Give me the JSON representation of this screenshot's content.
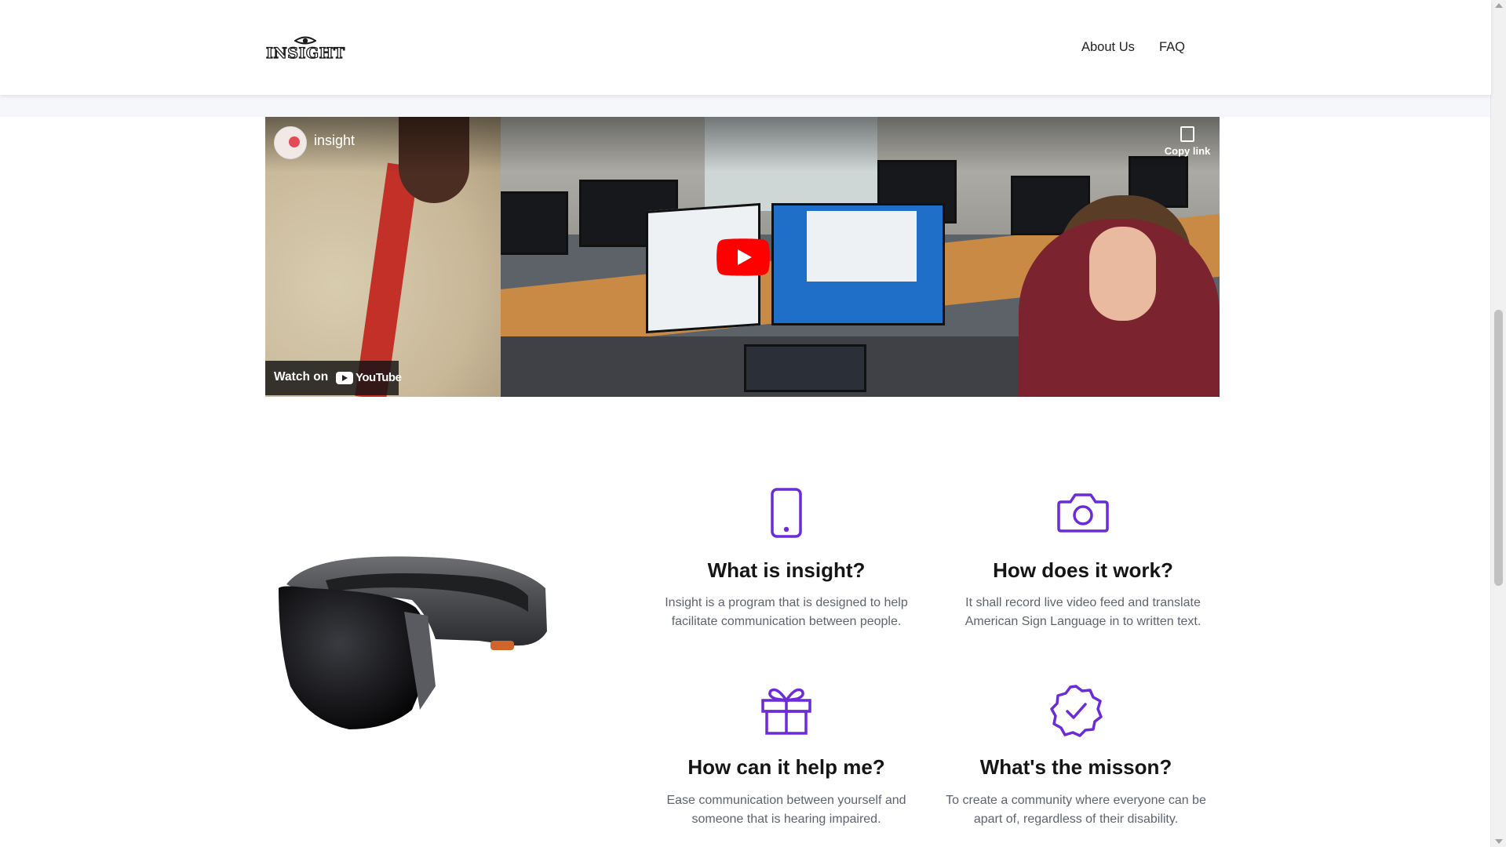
{
  "header": {
    "logo_text": "INSIGHT",
    "nav": [
      {
        "label": "About Us"
      },
      {
        "label": "FAQ"
      }
    ]
  },
  "page_scroll_progress": 0.2,
  "video": {
    "channel_name": "insight",
    "copy_link_label": "Copy link",
    "watch_on_label": "Watch on",
    "youtube_label": "YouTube"
  },
  "features": [
    {
      "icon": "phone-icon",
      "title": "What is insight?",
      "text": "Insight is a program that is designed to help facilitate communication between people."
    },
    {
      "icon": "camera-icon",
      "title": "How does it work?",
      "text": "It shall record live video feed and translate American Sign Language in to written text."
    },
    {
      "icon": "gift-icon",
      "title": "How can it help me?",
      "text": "Ease communication between yourself and someone that is hearing impaired."
    },
    {
      "icon": "badge-check-icon",
      "title": "What's the misson?",
      "text": "To create a community where everyone can be apart of, regardless of their disability."
    }
  ],
  "colors": {
    "accent": "#6c2bd9",
    "youtube_red": "#ff0000",
    "heading": "#151515",
    "body_text": "#5e636e"
  }
}
